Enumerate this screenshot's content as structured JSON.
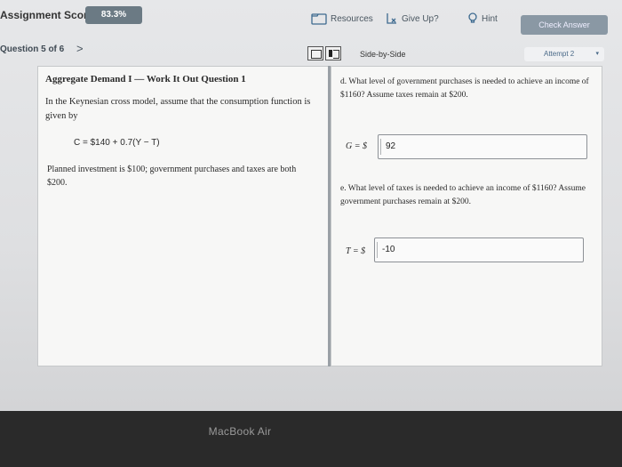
{
  "header": {
    "score_label": "Assignment Score:",
    "score_value": "83.3%",
    "resources_label": "Resources",
    "give_up_label": "Give Up?",
    "hint_label": "Hint",
    "check_answer_label": "Check Answer"
  },
  "nav": {
    "question_number": "Question 5 of 6",
    "next_glyph": ">",
    "side_by_side_label": "Side-by-Side",
    "attempt_label": "Attempt 2",
    "attempt_caret": "▾"
  },
  "left_panel": {
    "title": "Aggregate Demand I — Work It Out Question 1",
    "intro": "In the Keynesian cross model, assume that the consumption function is given by",
    "equation": "C = $140 + 0.7(Y − T)",
    "planned": "Planned investment is $100; government purchases and taxes are both $200."
  },
  "right_panel": {
    "part_d": "d. What level of government purchases is needed to achieve an income of $1160? Assume taxes remain at $200.",
    "g_label": "G = $",
    "g_value": "92",
    "part_e": "e. What level of taxes is needed to achieve an income of $1160? Assume government purchases remain at $200.",
    "t_label": "T = $",
    "t_value": "-10"
  },
  "device": {
    "bezel_label": "MacBook Air"
  },
  "icons": [
    "resources-icon",
    "give-up-icon",
    "hint-icon",
    "chevron-right-icon"
  ],
  "colors": {
    "score_badge": "#6b7a84",
    "check_button": "#8a98a4",
    "divider": "#9aa0a6"
  }
}
